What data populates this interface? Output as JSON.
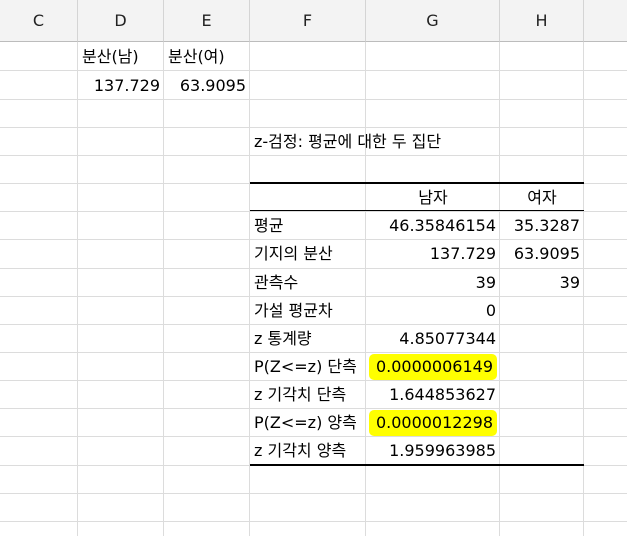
{
  "columns": {
    "C": "C",
    "D": "D",
    "E": "E",
    "F": "F",
    "G": "G",
    "H": "H"
  },
  "top": {
    "d1": "분산(남)",
    "e1": "분산(여)",
    "d2": "137.729",
    "e2": "63.9095"
  },
  "ztest": {
    "title": "z-검정: 평균에 대한 두 집단",
    "col_male": "남자",
    "col_female": "여자",
    "rows": [
      {
        "label": "평균",
        "male": "46.35846154",
        "female": "35.3287"
      },
      {
        "label": "기지의 분산",
        "male": "137.729",
        "female": "63.9095"
      },
      {
        "label": "관측수",
        "male": "39",
        "female": "39"
      },
      {
        "label": "가설 평균차",
        "male": "0",
        "female": ""
      },
      {
        "label": "z 통계량",
        "male": "4.85077344",
        "female": ""
      },
      {
        "label": "P(Z<=z) 단측",
        "male": "0.0000006149",
        "female": ""
      },
      {
        "label": "z 기각치 단측",
        "male": "1.644853627",
        "female": ""
      },
      {
        "label": "P(Z<=z) 양측",
        "male": "0.0000012298",
        "female": ""
      },
      {
        "label": "z 기각치 양측",
        "male": "1.959963985",
        "female": ""
      }
    ]
  },
  "colors": {
    "highlight": "#ffff00",
    "header_bg": "#f3f3f3",
    "grid": "#dcdcdc"
  }
}
